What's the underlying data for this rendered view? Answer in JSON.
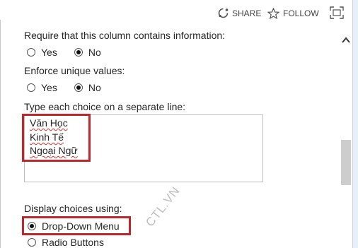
{
  "toolbar": {
    "share_label": "SHARE",
    "follow_label": "FOLLOW"
  },
  "form": {
    "required_question": "Require that this column contains information:",
    "required_options": {
      "yes": "Yes",
      "no": "No",
      "selected": "No"
    },
    "unique_question": "Enforce unique values:",
    "unique_options": {
      "yes": "Yes",
      "no": "No",
      "selected": "No"
    },
    "choices_label": "Type each choice on a separate line:",
    "choices": [
      "Văn Học",
      "Kinh Tế",
      "Ngoại Ngữ"
    ],
    "display_label": "Display choices using:",
    "display_options": {
      "dropdown": "Drop-Down Menu",
      "radio": "Radio Buttons",
      "selected": "Drop-Down Menu"
    }
  },
  "watermark": "CTL.VN",
  "colors": {
    "highlight": "#c0272d",
    "text": "#262626"
  }
}
